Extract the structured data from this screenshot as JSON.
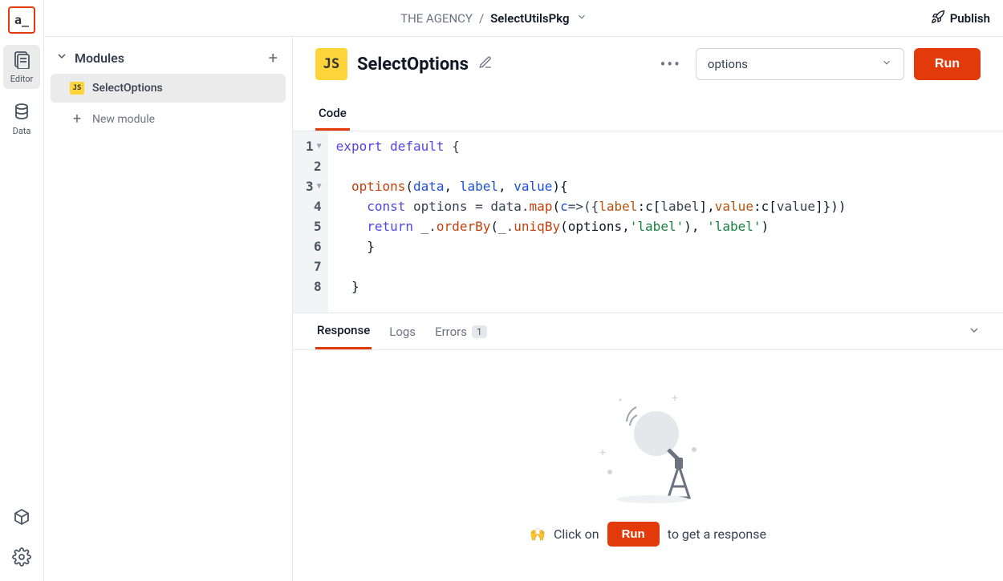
{
  "logo_text": "a_",
  "rail": {
    "editor": "Editor",
    "data": "Data"
  },
  "breadcrumb": {
    "org": "THE AGENCY",
    "sep": "/",
    "pkg": "SelectUtilsPkg"
  },
  "publish_label": "Publish",
  "sidebar": {
    "heading": "Modules",
    "items": [
      {
        "label": "SelectOptions"
      }
    ],
    "new_label": "New module"
  },
  "editor": {
    "module_name": "SelectOptions",
    "function_select": "options",
    "run_label": "Run",
    "tabs": {
      "code": "Code"
    },
    "code": {
      "lines": [
        "1",
        "2",
        "3",
        "4",
        "5",
        "6",
        "7",
        "8"
      ],
      "line1": {
        "kw1": "export",
        "kw2": "default",
        "brace": "{"
      },
      "line3": {
        "fn": "options",
        "p1": "data",
        "p2": "label",
        "p3": "value",
        "tail": "){"
      },
      "line4": {
        "kw": "const",
        "id": "options",
        "eq": "=",
        "obj": "data",
        "dot": ".",
        "map": "map",
        "arg": "c",
        "arrow": "=>",
        "open": "({",
        "k1": "label",
        "c1": ":c[",
        "v1": "label",
        "mid": "],",
        "k2": "value",
        "c2": ":c[",
        "v2": "value",
        "close": "]}))"
      },
      "line5": {
        "kw": "return",
        "u": "_",
        "dot": ".",
        "orderBy": "orderBy",
        "open": "(",
        "u2": "_",
        "dot2": ".",
        "uniqBy": "uniqBy",
        "open2": "(options,",
        "s1": "'label'",
        "mid": "),",
        "sp": " ",
        "s2": "'label'",
        "close": ")"
      },
      "line6": "    }",
      "line8": "  }"
    }
  },
  "response": {
    "tabs": {
      "response": "Response",
      "logs": "Logs",
      "errors": "Errors",
      "error_count": "1"
    },
    "hint_emoji": "🙌",
    "hint_before": "Click on",
    "hint_run": "Run",
    "hint_after": "to get a response"
  }
}
